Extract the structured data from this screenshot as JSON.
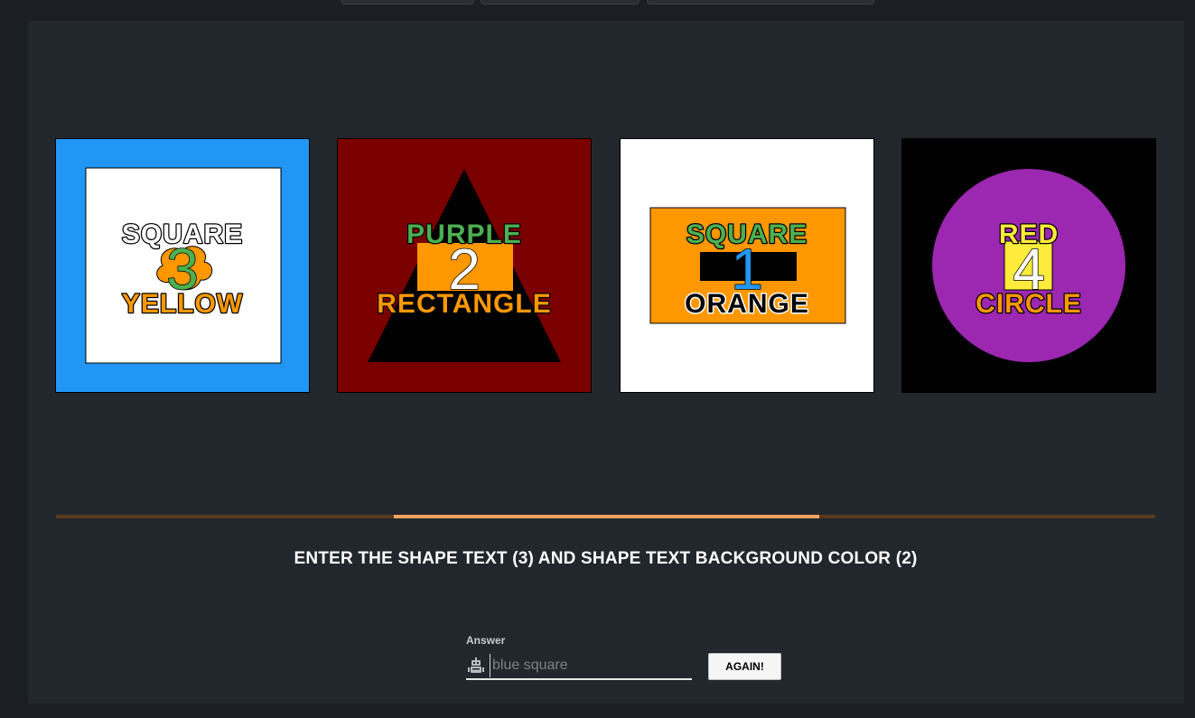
{
  "progress": {
    "start_fraction": 0.307,
    "end_fraction": 0.694
  },
  "instruction": "ENTER THE SHAPE TEXT (3) AND SHAPE TEXT BACKGROUND COLOR (2)",
  "answer": {
    "label": "Answer",
    "placeholder": "blue square",
    "value": "",
    "icon": "robot-icon"
  },
  "again_button": "AGAIN!",
  "cards": [
    {
      "background": "#2196f3",
      "shape": "square",
      "shape_color": "#ffffff",
      "top_text": "SQUARE",
      "top_text_color": "#ffffff",
      "bottom_text": "YELLOW",
      "bottom_text_color": "#ff9800",
      "number": "3",
      "number_color": "#4caf50",
      "number_background_shape": "cloud",
      "number_background_color": "#ff9800"
    },
    {
      "background": "#7b0000",
      "shape": "triangle",
      "shape_color": "#000000",
      "top_text": "PURPLE",
      "top_text_color": "#4caf50",
      "bottom_text": "RECTANGLE",
      "bottom_text_color": "#ff9800",
      "number": "2",
      "number_color": "#ffffff",
      "number_background_shape": "rectangle",
      "number_background_color": "#ff9800"
    },
    {
      "background": "#ffffff",
      "shape": "rectangle",
      "shape_color": "#ff9800",
      "top_text": "SQUARE",
      "top_text_color": "#4caf50",
      "bottom_text": "ORANGE",
      "bottom_text_color": "#000000",
      "number": "1",
      "number_color": "#2196f3",
      "number_background_shape": "rectangle",
      "number_background_color": "#000000"
    },
    {
      "background": "#000000",
      "shape": "circle",
      "shape_color": "#9c27b0",
      "top_text": "RED",
      "top_text_color": "#ffeb3b",
      "bottom_text": "CIRCLE",
      "bottom_text_color": "#ff9800",
      "number": "4",
      "number_color": "#ffffff",
      "number_background_shape": "square",
      "number_background_color": "#ffeb3b"
    }
  ]
}
